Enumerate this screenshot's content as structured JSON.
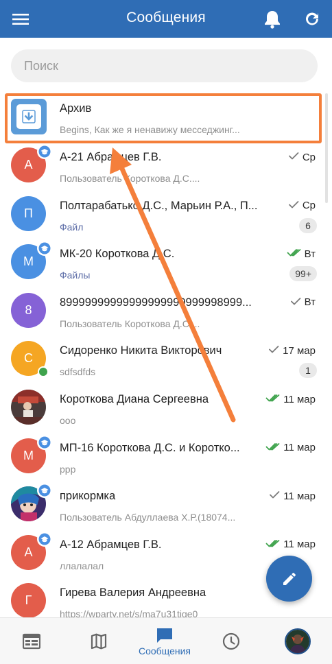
{
  "header": {
    "title": "Сообщения",
    "icons": {
      "menu": "menu-icon",
      "bell": "bell-icon",
      "refresh": "refresh-icon"
    }
  },
  "search": {
    "placeholder": "Поиск",
    "value": ""
  },
  "archive": {
    "title": "Архив",
    "preview": "Begins, Как же я ненавижу месседжинг..."
  },
  "chats": [
    {
      "title": "А-21 Абрамцев Г.В.",
      "subtitle": "Пользователь Короткова Д.С....",
      "time": "Ср",
      "status": "read-single",
      "avatar_letter": "А",
      "avatar_color": "#e35d4b",
      "edu_badge": true
    },
    {
      "title": "Полтарабатько Д.С., Марьин Р.А., П...",
      "subtitle": "Файл",
      "time": "Ср",
      "status": "read-single",
      "count": "6",
      "avatar_letter": "П",
      "avatar_color": "#4a90e2"
    },
    {
      "title": "МК-20 Короткова Д.С.",
      "subtitle": "Файлы",
      "time": "Вт",
      "status": "read-double",
      "count": "99+",
      "avatar_letter": "М",
      "avatar_color": "#4a90e2",
      "edu_badge": true
    },
    {
      "title": "89999999999999999999999998999...",
      "subtitle": "Пользователь Короткова Д.С....",
      "time": "Вт",
      "status": "read-single",
      "avatar_letter": "8",
      "avatar_color": "#8562d6"
    },
    {
      "title": "Сидоренко Никита Викторович",
      "subtitle": "sdfsdfds",
      "time": "17 мар",
      "status": "read-single",
      "count": "1",
      "avatar_letter": "С",
      "avatar_color": "#f5a623",
      "online": true
    },
    {
      "title": "Короткова Диана Сергеевна",
      "subtitle": "ооо",
      "time": "11 мар",
      "status": "read-double",
      "avatar_photo": "photo-avatar-1"
    },
    {
      "title": "МП-16 Короткова Д.С. и Коротко...",
      "subtitle": "ррр",
      "time": "11 мар",
      "status": "read-double",
      "avatar_letter": "М",
      "avatar_color": "#e35d4b",
      "edu_badge": true
    },
    {
      "title": "прикормка",
      "subtitle": "Пользователь Абдуллаева Х.Р.(18074...",
      "time": "11 мар",
      "status": "read-single",
      "avatar_photo": "photo-avatar-2",
      "edu_badge": true
    },
    {
      "title": "А-12 Абрамцев Г.В.",
      "subtitle": "ллалалал",
      "time": "11 мар",
      "status": "read-double",
      "avatar_letter": "А",
      "avatar_color": "#e35d4b",
      "edu_badge": true
    },
    {
      "title": "Гирева Валерия Андреевна",
      "subtitle": "https://wparty.net/s/ma7u31tige0",
      "time": "",
      "status": "",
      "avatar_letter": "Г",
      "avatar_color": "#e35d4b"
    }
  ],
  "fab": {
    "icon": "pencil-icon"
  },
  "bottom_nav": {
    "items": [
      {
        "icon": "schedule-icon",
        "label": ""
      },
      {
        "icon": "map-icon",
        "label": ""
      },
      {
        "icon": "chat-icon",
        "label": "Сообщения",
        "active": true
      },
      {
        "icon": "clock-icon",
        "label": ""
      },
      {
        "icon": "profile-avatar",
        "label": ""
      }
    ]
  },
  "colors": {
    "primary": "#2f6db5",
    "highlight": "#f47f3b",
    "read_check_green": "#3fa34d",
    "text_muted": "#8e8e8e"
  }
}
